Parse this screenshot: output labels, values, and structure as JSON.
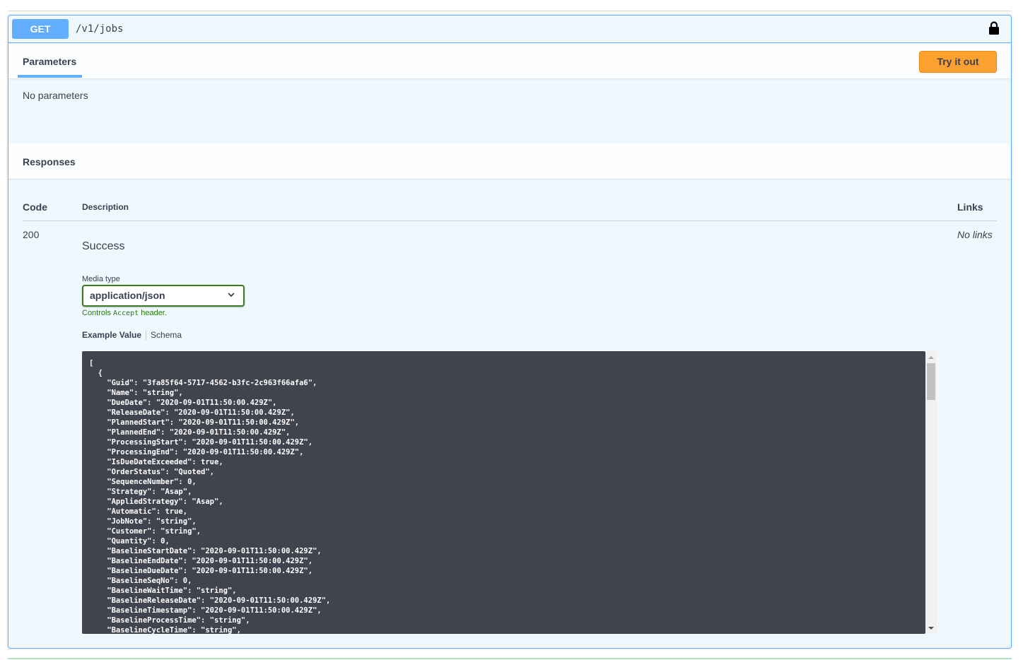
{
  "endpoint": {
    "method": "GET",
    "path": "/v1/jobs",
    "lock_icon": "lock-icon"
  },
  "parameters": {
    "tab_label": "Parameters",
    "try_button": "Try it out",
    "empty_text": "No parameters"
  },
  "responses": {
    "title": "Responses",
    "columns": {
      "code": "Code",
      "description": "Description",
      "links": "Links"
    },
    "rows": [
      {
        "code": "200",
        "description": "Success",
        "links": "No links",
        "media_type_label": "Media type",
        "media_type_value": "application/json",
        "controls_prefix": "Controls",
        "controls_code": "Accept",
        "controls_suffix": "header.",
        "tab_example": "Example Value",
        "tab_schema": "Schema",
        "example_json": "[\n  {\n    \"Guid\": \"3fa85f64-5717-4562-b3fc-2c963f66afa6\",\n    \"Name\": \"string\",\n    \"DueDate\": \"2020-09-01T11:50:00.429Z\",\n    \"ReleaseDate\": \"2020-09-01T11:50:00.429Z\",\n    \"PlannedStart\": \"2020-09-01T11:50:00.429Z\",\n    \"PlannedEnd\": \"2020-09-01T11:50:00.429Z\",\n    \"ProcessingStart\": \"2020-09-01T11:50:00.429Z\",\n    \"ProcessingEnd\": \"2020-09-01T11:50:00.429Z\",\n    \"IsDueDateExceeded\": true,\n    \"OrderStatus\": \"Quoted\",\n    \"SequenceNumber\": 0,\n    \"Strategy\": \"Asap\",\n    \"AppliedStrategy\": \"Asap\",\n    \"Automatic\": true,\n    \"JobNote\": \"string\",\n    \"Customer\": \"string\",\n    \"Quantity\": 0,\n    \"BaselineStartDate\": \"2020-09-01T11:50:00.429Z\",\n    \"BaselineEndDate\": \"2020-09-01T11:50:00.429Z\",\n    \"BaselineDueDate\": \"2020-09-01T11:50:00.429Z\",\n    \"BaselineSeqNo\": 0,\n    \"BaselineWaitTime\": \"string\",\n    \"BaselineReleaseDate\": \"2020-09-01T11:50:00.429Z\",\n    \"BaselineTimestamp\": \"2020-09-01T11:50:00.429Z\",\n    \"BaselineProcessTime\": \"string\",\n    \"BaselineCycleTime\": \"string\","
      }
    ]
  }
}
